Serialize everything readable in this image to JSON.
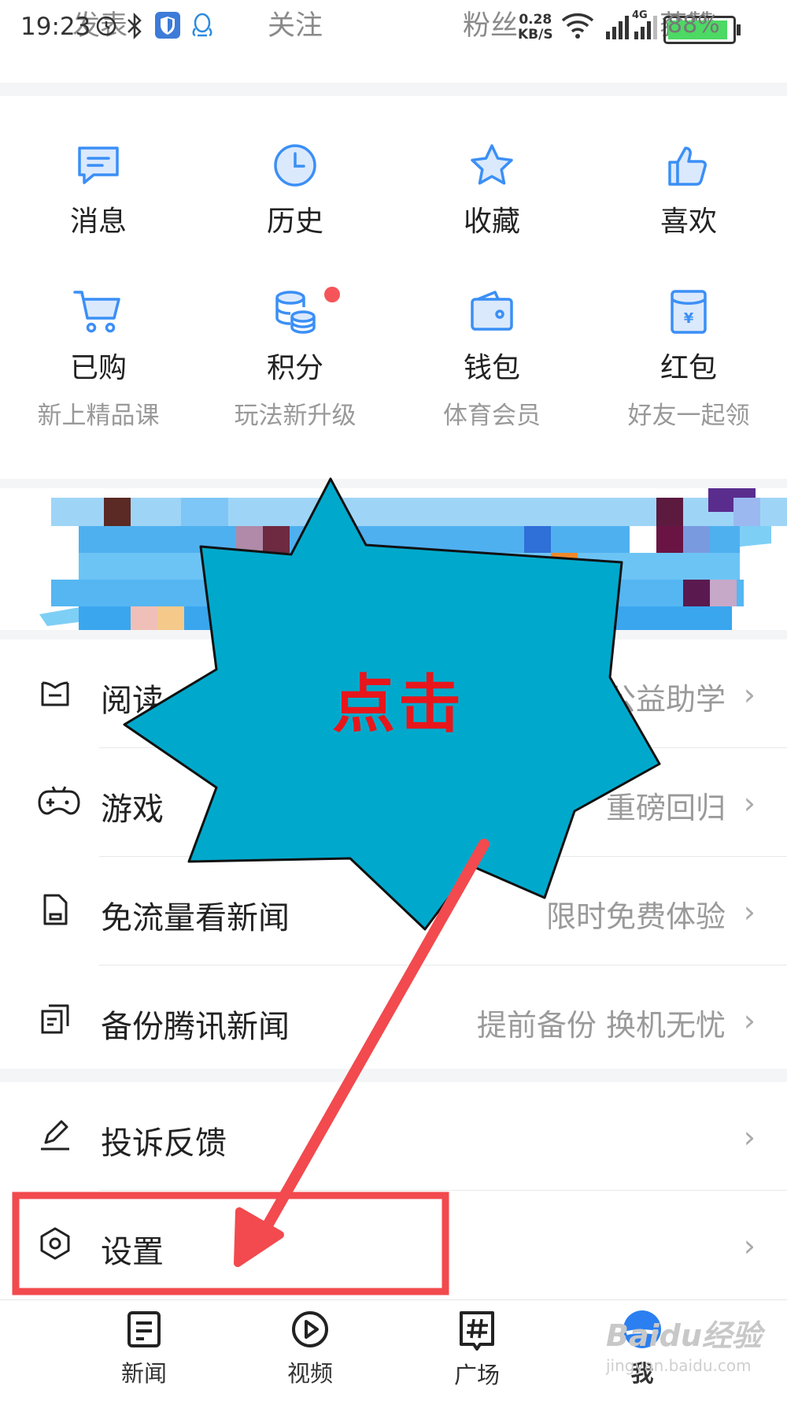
{
  "status_bar": {
    "time": "19:23",
    "speed_value": "0.28",
    "speed_unit": "KB/S",
    "network": "4G",
    "battery": "88%"
  },
  "profile_tabs": [
    "发表",
    "关注",
    "粉丝",
    "获赞"
  ],
  "grid": {
    "row1": [
      {
        "label": "消息",
        "icon": "message-icon"
      },
      {
        "label": "历史",
        "icon": "clock-icon"
      },
      {
        "label": "收藏",
        "icon": "star-icon"
      },
      {
        "label": "喜欢",
        "icon": "thumbs-up-icon"
      }
    ],
    "row2": [
      {
        "label": "已购",
        "sub": "新上精品课",
        "icon": "cart-icon"
      },
      {
        "label": "积分",
        "sub": "玩法新升级",
        "icon": "coins-icon",
        "badge": true
      },
      {
        "label": "钱包",
        "sub": "体育会员",
        "icon": "wallet-icon"
      },
      {
        "label": "红包",
        "sub": "好友一起领",
        "icon": "red-envelope-icon"
      }
    ]
  },
  "list_section_1": [
    {
      "label": "阅读",
      "hint": "公益助学",
      "icon": "reading-icon"
    },
    {
      "label": "游戏",
      "hint": "重磅回归",
      "icon": "gamepad-icon"
    },
    {
      "label": "免流量看新闻",
      "hint": "限时免费体验",
      "icon": "sim-card-icon"
    },
    {
      "label": "备份腾讯新闻",
      "hint": "提前备份 换机无忧",
      "icon": "backup-icon"
    }
  ],
  "list_section_2": [
    {
      "label": "投诉反馈",
      "hint": "",
      "icon": "edit-icon"
    },
    {
      "label": "设置",
      "hint": "",
      "icon": "settings-icon"
    }
  ],
  "chevron": "›",
  "bottom_nav": [
    {
      "label": "新闻",
      "icon": "news-icon"
    },
    {
      "label": "视频",
      "icon": "video-icon"
    },
    {
      "label": "广场",
      "icon": "hashtag-icon"
    },
    {
      "label": "我",
      "icon": "me-icon"
    }
  ],
  "annotation": {
    "callout_text": "点击"
  },
  "watermark": {
    "text": "Baidu经验",
    "url": "jingyan.baidu.com"
  },
  "colors": {
    "accent_blue": "#3b8ff6",
    "badge_red": "#f5555a",
    "callout_fill": "#00a9cc",
    "highlight_red": "#f24a4e"
  }
}
